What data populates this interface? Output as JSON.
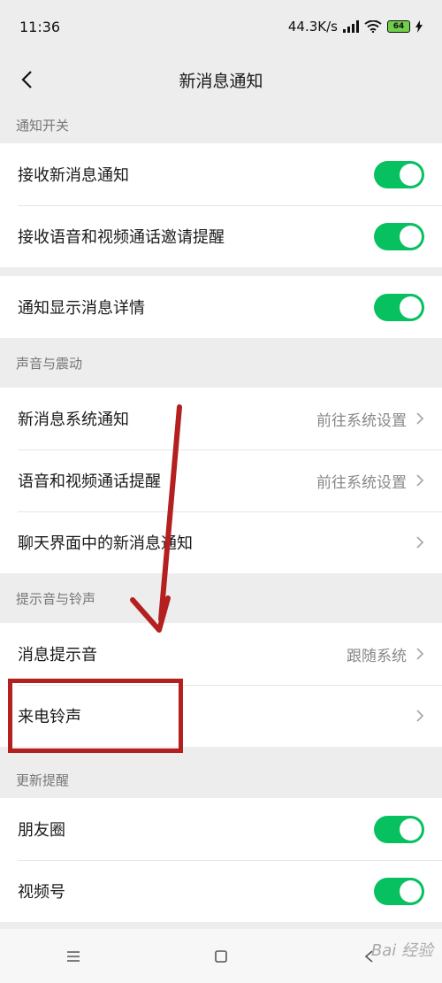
{
  "status": {
    "time": "11:36",
    "network_speed": "44.3K/s",
    "battery": "64"
  },
  "header": {
    "title": "新消息通知"
  },
  "sections": {
    "notify_switch": "通知开关",
    "sound_vibrate": "声音与震动",
    "tone_ringtone": "提示音与铃声",
    "update_reminder": "更新提醒"
  },
  "rows": {
    "receive_new": {
      "label": "接收新消息通知",
      "on": true
    },
    "receive_call_invite": {
      "label": "接收语音和视频通话邀请提醒",
      "on": true
    },
    "show_detail": {
      "label": "通知显示消息详情",
      "on": true
    },
    "system_notify": {
      "label": "新消息系统通知",
      "value": "前往系统设置"
    },
    "call_reminder": {
      "label": "语音和视频通话提醒",
      "value": "前往系统设置"
    },
    "chat_notify": {
      "label": "聊天界面中的新消息通知"
    },
    "message_tone": {
      "label": "消息提示音",
      "value": "跟随系统"
    },
    "ringtone": {
      "label": "来电铃声"
    },
    "moments": {
      "label": "朋友圈",
      "on": true
    },
    "channels": {
      "label": "视频号",
      "on": true
    }
  },
  "watermark": "Bai 经验",
  "colors": {
    "toggle_on": "#07c160",
    "highlight": "#b3201f",
    "arrow": "#b3201f"
  }
}
